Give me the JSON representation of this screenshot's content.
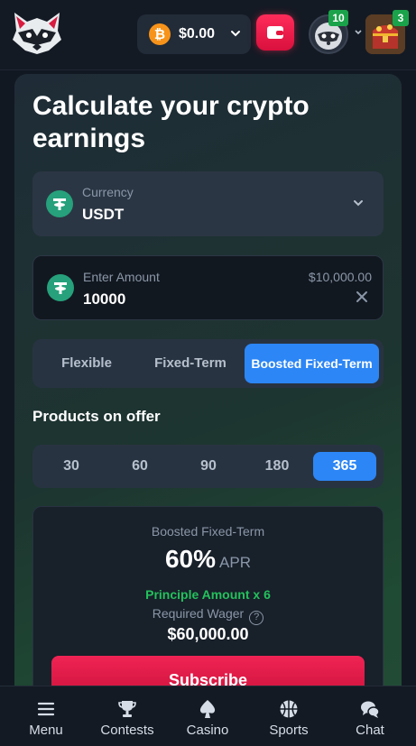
{
  "header": {
    "balance": "$0.00",
    "level_badge": "10",
    "chest_badge": "3"
  },
  "calculator": {
    "title": "Calculate your crypto earnings",
    "currency": {
      "label": "Currency",
      "value": "USDT"
    },
    "amount": {
      "placeholder": "Enter Amount",
      "value": "10000",
      "max": "$10,000.00"
    },
    "terms": [
      "Flexible",
      "Fixed-Term",
      "Boosted Fixed-Term"
    ],
    "selected_term": "Boosted Fixed-Term",
    "products_title": "Products on offer",
    "days": [
      "30",
      "60",
      "90",
      "180",
      "365"
    ],
    "selected_days": "365",
    "offer": {
      "type": "Boosted Fixed-Term",
      "apr_value": "60%",
      "apr_label": "APR",
      "principle": "Principle Amount x 6",
      "wager_label": "Required Wager",
      "wager_value": "$60,000.00",
      "subscribe_label": "Subscribe"
    }
  },
  "nav": [
    {
      "label": "Menu",
      "icon": "menu-icon"
    },
    {
      "label": "Contests",
      "icon": "trophy-icon"
    },
    {
      "label": "Casino",
      "icon": "spade-icon"
    },
    {
      "label": "Sports",
      "icon": "basketball-icon"
    },
    {
      "label": "Chat",
      "icon": "chat-icon"
    }
  ],
  "colors": {
    "accent_blue": "#2c86f5",
    "accent_red": "#e91a4a",
    "success_green": "#23c15c",
    "tether_green": "#26a17b",
    "bitcoin_orange": "#f7931a"
  }
}
